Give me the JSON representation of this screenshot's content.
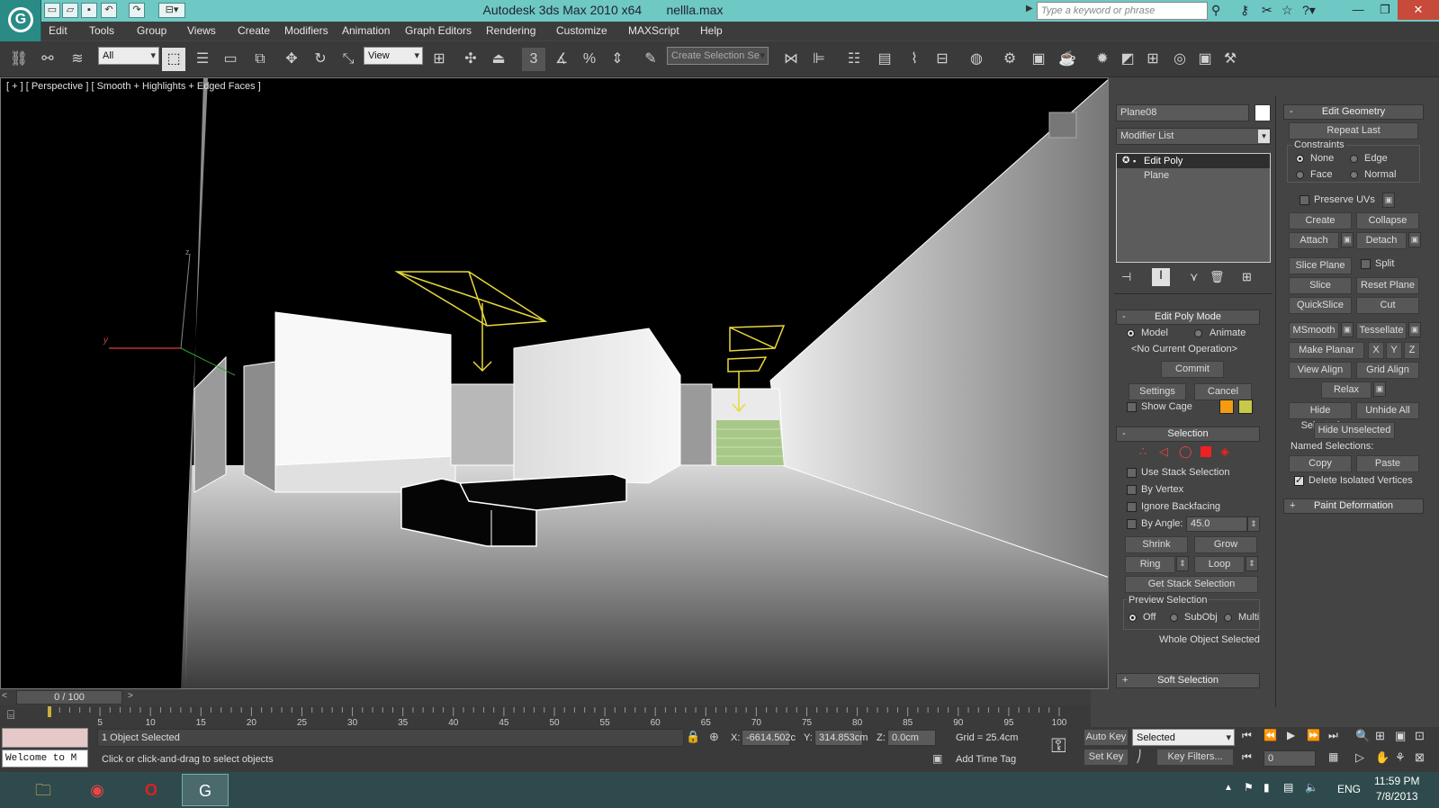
{
  "window": {
    "app_title": "Autodesk 3ds Max  2010 x64",
    "file_name": "nellla.max",
    "search_placeholder": "Type a keyword or phrase",
    "min_label": "—",
    "restore_label": "❐",
    "close_label": "✕"
  },
  "menu": [
    "Edit",
    "Tools",
    "Group",
    "Views",
    "Create",
    "Modifiers",
    "Animation",
    "Graph Editors",
    "Rendering",
    "Customize",
    "MAXScript",
    "Help"
  ],
  "toolbar": {
    "filter_value": "All",
    "ref_coord_value": "View",
    "selection_set_placeholder": "Create Selection Se",
    "snap_label": "3"
  },
  "viewport": {
    "label": "[ + ] [ Perspective ] [ Smooth + Highlights + Edged Faces ]",
    "axis_z": "z",
    "axis_y": "y"
  },
  "command_panel": {
    "object_name": "Plane08",
    "object_color": "#ffffff",
    "modifier_list": "Modifier List",
    "stack": [
      {
        "label": "Edit Poly",
        "selected": true
      },
      {
        "label": "Plane",
        "selected": false
      }
    ],
    "edit_poly_mode": {
      "title": "Edit Poly Mode",
      "model_label": "Model",
      "animate_label": "Animate",
      "current_op": "<No Current Operation>",
      "commit": "Commit",
      "settings": "Settings",
      "cancel": "Cancel",
      "show_cage": "Show Cage",
      "cage_color1": "#f39c12",
      "cage_color2": "#c8c84a"
    },
    "selection": {
      "title": "Selection",
      "use_stack": "Use Stack Selection",
      "by_vertex": "By Vertex",
      "ignore_backfacing": "Ignore Backfacing",
      "by_angle": "By Angle:",
      "angle_value": "45.0",
      "shrink": "Shrink",
      "grow": "Grow",
      "ring": "Ring",
      "loop": "Loop",
      "get_stack": "Get Stack Selection",
      "preview_title": "Preview Selection",
      "preview_off": "Off",
      "preview_subobj": "SubObj",
      "preview_multi": "Multi",
      "status": "Whole Object Selected"
    },
    "soft_selection": "Soft Selection",
    "edit_geometry": {
      "title": "Edit Geometry",
      "repeat_last": "Repeat Last",
      "constraints": "Constraints",
      "none": "None",
      "edge": "Edge",
      "face": "Face",
      "normal": "Normal",
      "preserve_uvs": "Preserve UVs",
      "create": "Create",
      "collapse": "Collapse",
      "attach": "Attach",
      "detach": "Detach",
      "slice_plane": "Slice Plane",
      "split": "Split",
      "slice": "Slice",
      "reset_plane": "Reset Plane",
      "quickslice": "QuickSlice",
      "cut": "Cut",
      "msmooth": "MSmooth",
      "tessellate": "Tessellate",
      "make_planar": "Make Planar",
      "x": "X",
      "y": "Y",
      "z": "Z",
      "view_align": "View Align",
      "grid_align": "Grid Align",
      "relax": "Relax",
      "hide_selected": "Hide Selected",
      "unhide_all": "Unhide All",
      "hide_unselected": "Hide Unselected",
      "named_selections": "Named Selections:",
      "copy": "Copy",
      "paste": "Paste",
      "delete_isolated": "Delete Isolated Vertices"
    },
    "paint_deformation": "Paint Deformation"
  },
  "timeline": {
    "frame_display": "0 / 100",
    "ticks": [
      "5",
      "10",
      "15",
      "20",
      "25",
      "30",
      "35",
      "40",
      "45",
      "50",
      "55",
      "60",
      "65",
      "70",
      "75",
      "80",
      "85",
      "90",
      "95",
      "100"
    ]
  },
  "status": {
    "maxscript_listener": "Welcome to M",
    "selection_count": "1 Object Selected",
    "prompt": "Click or click-and-drag to select objects",
    "x_label": "X:",
    "x_value": "-6614.502c",
    "y_label": "Y:",
    "y_value": "314.853cm",
    "z_label": "Z:",
    "z_value": "0.0cm",
    "grid": "Grid = 25.4cm",
    "add_time_tag": "Add Time Tag",
    "auto_key": "Auto Key",
    "set_key": "Set Key",
    "key_mode": "Selected",
    "key_filters": "Key Filters...",
    "current_frame": "0"
  },
  "taskbar": {
    "lang": "ENG",
    "time": "11:59 PM",
    "date": "7/8/2013"
  }
}
